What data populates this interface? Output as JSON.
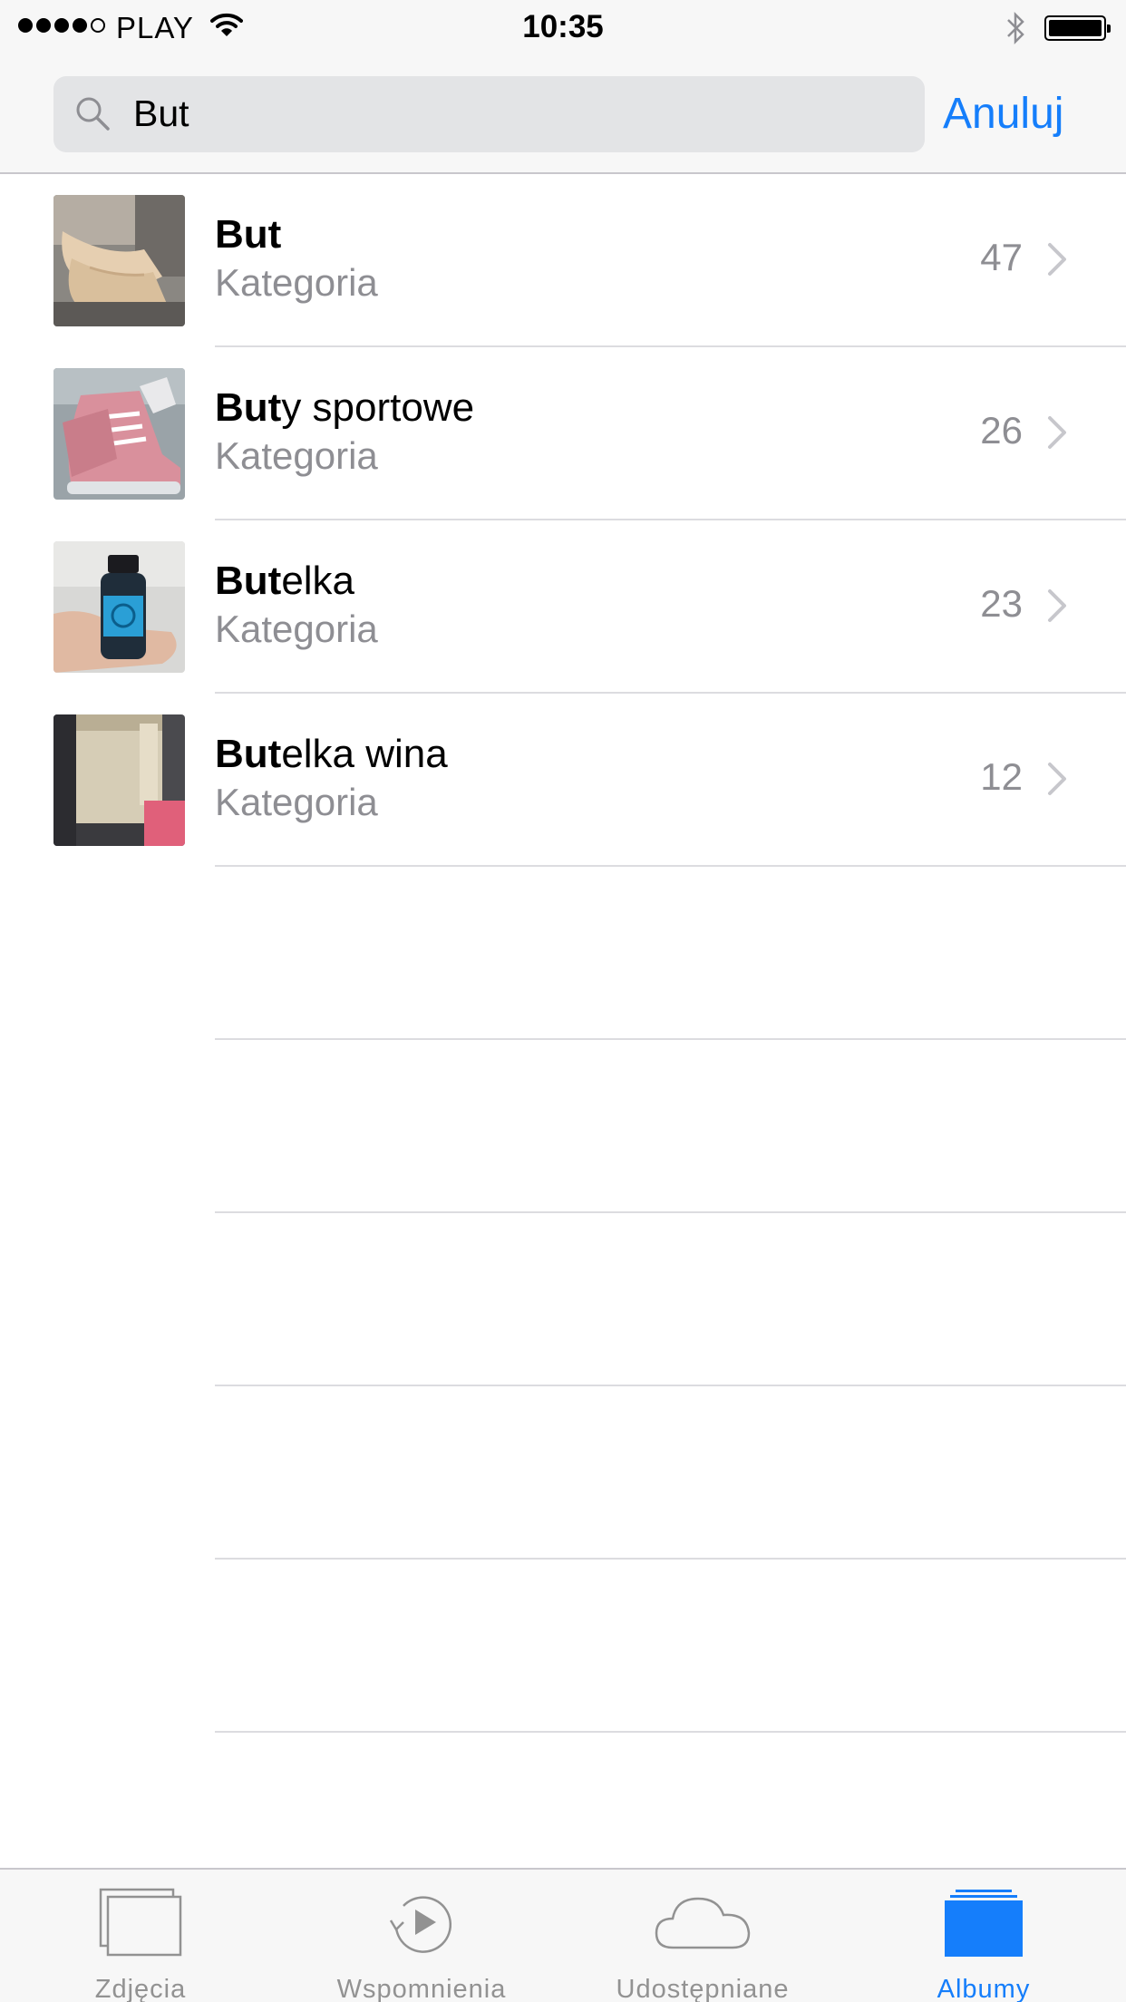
{
  "status_bar": {
    "carrier": "PLAY",
    "time": "10:35",
    "signal_dots_filled": 4,
    "signal_dots_total": 5
  },
  "search": {
    "query": "But",
    "cancel_label": "Anuluj",
    "accent_color": "#157efb"
  },
  "results": [
    {
      "highlight": "But",
      "rest": "",
      "subtitle": "Kategoria",
      "count": "47",
      "thumb": "beige-heels"
    },
    {
      "highlight": "But",
      "rest": "y sportowe",
      "subtitle": "Kategoria",
      "count": "26",
      "thumb": "pink-boots"
    },
    {
      "highlight": "But",
      "rest": "elka",
      "subtitle": "Kategoria",
      "count": "23",
      "thumb": "blue-bottle"
    },
    {
      "highlight": "But",
      "rest": "elka wina",
      "subtitle": "Kategoria",
      "count": "12",
      "thumb": "cream-bottle"
    }
  ],
  "tab_bar": {
    "tabs": [
      {
        "label": "Zdjęcia",
        "icon": "photos-icon",
        "active": false
      },
      {
        "label": "Wspomnienia",
        "icon": "memories-icon",
        "active": false
      },
      {
        "label": "Udostępniane",
        "icon": "cloud-icon",
        "active": false
      },
      {
        "label": "Albumy",
        "icon": "albums-icon",
        "active": true
      }
    ]
  }
}
